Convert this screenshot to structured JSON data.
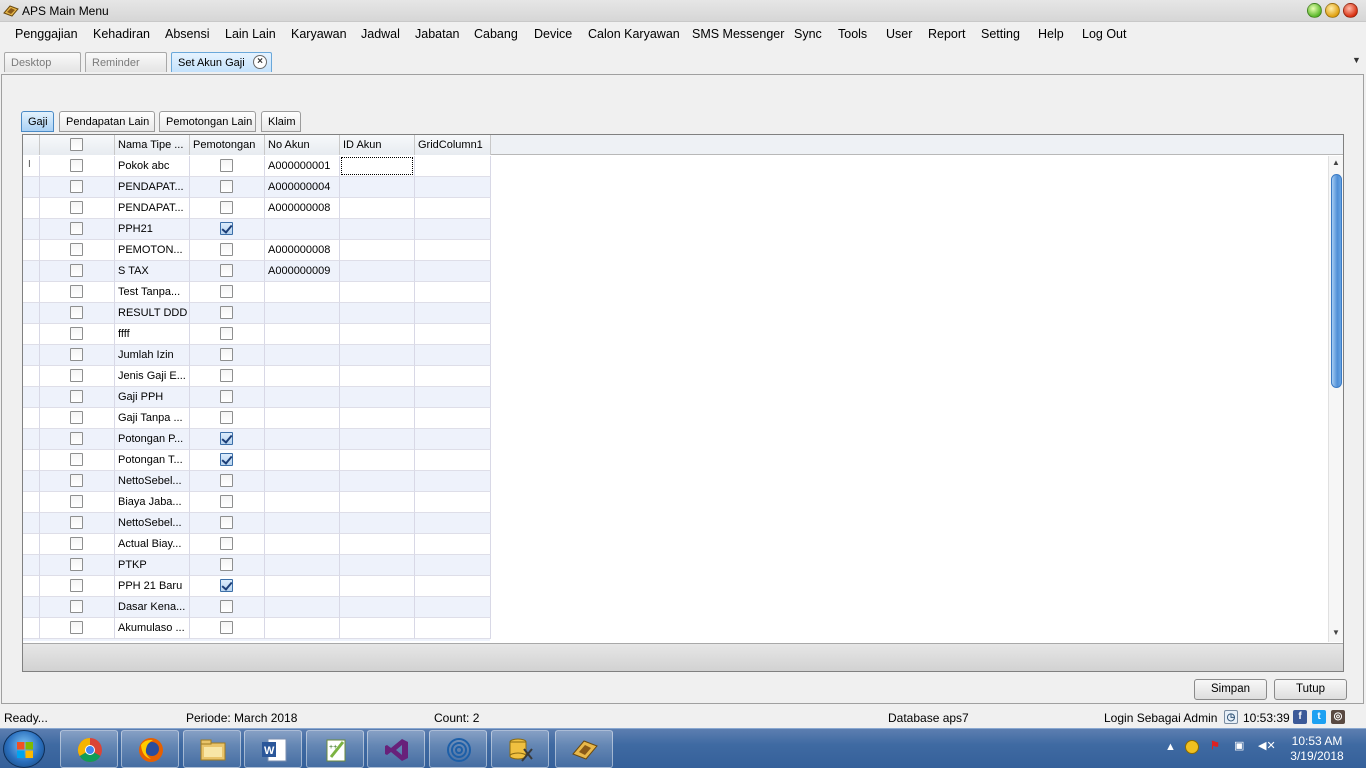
{
  "window": {
    "title": "APS Main Menu"
  },
  "menu": [
    "Penggajian",
    "Kehadiran",
    "Absensi",
    "Lain Lain",
    "Karyawan",
    "Jadwal",
    "Jabatan",
    "Cabang",
    "Device",
    "Calon Karyawan",
    "SMS Messenger",
    "Sync",
    "Tools",
    "User",
    "Report",
    "Setting",
    "Help",
    "Log Out"
  ],
  "doc_tabs": [
    {
      "label": "Desktop",
      "active": false
    },
    {
      "label": "Reminder",
      "active": false
    },
    {
      "label": "Set Akun Gaji",
      "active": true
    }
  ],
  "sub_tabs": [
    {
      "label": "Gaji",
      "active": true
    },
    {
      "label": "Pendapatan Lain",
      "active": false
    },
    {
      "label": "Pemotongan Lain",
      "active": false
    },
    {
      "label": "Klaim",
      "active": false
    }
  ],
  "grid": {
    "columns": [
      "",
      "Nama Tipe ...",
      "Pemotongan",
      "No Akun",
      "ID Akun",
      "GridColumn1"
    ],
    "rows": [
      {
        "nama": "Pokok abc",
        "pemotongan": false,
        "no_akun": "A000000001"
      },
      {
        "nama": "PENDAPAT...",
        "pemotongan": false,
        "no_akun": "A000000004"
      },
      {
        "nama": "PENDAPAT...",
        "pemotongan": false,
        "no_akun": "A000000008"
      },
      {
        "nama": "PPH21",
        "pemotongan": true,
        "no_akun": ""
      },
      {
        "nama": "PEMOTON...",
        "pemotongan": false,
        "no_akun": "A000000008"
      },
      {
        "nama": "S TAX",
        "pemotongan": false,
        "no_akun": "A000000009"
      },
      {
        "nama": "Test Tanpa...",
        "pemotongan": false,
        "no_akun": ""
      },
      {
        "nama": "RESULT DDD",
        "pemotongan": false,
        "no_akun": ""
      },
      {
        "nama": "ffff",
        "pemotongan": false,
        "no_akun": ""
      },
      {
        "nama": "Jumlah Izin",
        "pemotongan": false,
        "no_akun": ""
      },
      {
        "nama": "Jenis Gaji E...",
        "pemotongan": false,
        "no_akun": ""
      },
      {
        "nama": "Gaji PPH",
        "pemotongan": false,
        "no_akun": ""
      },
      {
        "nama": "Gaji Tanpa ...",
        "pemotongan": false,
        "no_akun": ""
      },
      {
        "nama": "Potongan P...",
        "pemotongan": true,
        "no_akun": ""
      },
      {
        "nama": "Potongan T...",
        "pemotongan": true,
        "no_akun": ""
      },
      {
        "nama": "NettoSebel...",
        "pemotongan": false,
        "no_akun": ""
      },
      {
        "nama": "Biaya Jaba...",
        "pemotongan": false,
        "no_akun": ""
      },
      {
        "nama": "NettoSebel...",
        "pemotongan": false,
        "no_akun": ""
      },
      {
        "nama": "Actual Biay...",
        "pemotongan": false,
        "no_akun": ""
      },
      {
        "nama": "PTKP",
        "pemotongan": false,
        "no_akun": ""
      },
      {
        "nama": "PPH 21 Baru",
        "pemotongan": true,
        "no_akun": ""
      },
      {
        "nama": "Dasar Kena...",
        "pemotongan": false,
        "no_akun": ""
      },
      {
        "nama": "Akumulaso ...",
        "pemotongan": false,
        "no_akun": ""
      }
    ]
  },
  "buttons": {
    "simpan": "Simpan",
    "tutup": "Tutup"
  },
  "status": {
    "ready": "Ready...",
    "periode": "Periode: March 2018",
    "count": "Count: 2",
    "database": "Database aps7",
    "login": "Login Sebagai Admin",
    "time": "10:53:39"
  },
  "taskbar": {
    "apps": [
      "chrome-icon",
      "firefox-icon",
      "file-explorer-icon",
      "word-icon",
      "notepad-plus-plus-icon",
      "visual-studio-icon",
      "fingerprint-icon",
      "database-tools-icon",
      "aps-app-icon"
    ],
    "clock_time": "10:53 AM",
    "clock_date": "3/19/2018"
  },
  "colors": {
    "active_tab": "#c4e2fc",
    "accent": "#4a8ac6",
    "taskbar": "#3f6aa2"
  }
}
